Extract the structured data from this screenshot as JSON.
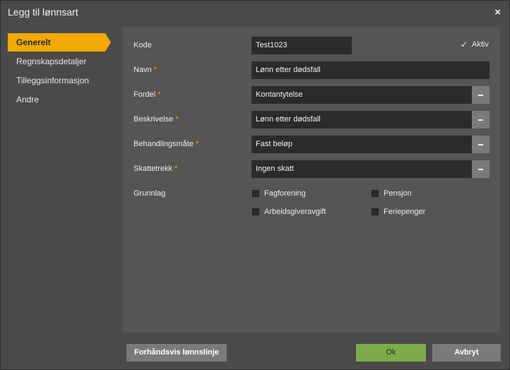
{
  "dialog": {
    "title": "Legg til lønnsart",
    "close_glyph": "×"
  },
  "sidebar": {
    "items": [
      {
        "label": "Generelt",
        "active": true
      },
      {
        "label": "Regnskapsdetaljer",
        "active": false
      },
      {
        "label": "Tilleggsinformasjon",
        "active": false
      },
      {
        "label": "Andre",
        "active": false
      }
    ]
  },
  "form": {
    "kode": {
      "label": "Kode",
      "value": "Test1023"
    },
    "aktiv": {
      "label": "Aktiv",
      "checked": true,
      "glyph": "✓"
    },
    "navn": {
      "label": "Navn",
      "required": "*",
      "value": "Lønn etter dødsfall"
    },
    "fordel": {
      "label": "Fordel",
      "required": "*",
      "value": "Kontantytelse"
    },
    "beskrivelse": {
      "label": "Beskrivelse",
      "required": "*",
      "value": "Lønn etter dødsfall"
    },
    "behandlingsmate": {
      "label": "Behandlingsmåte",
      "required": "*",
      "value": "Fast beløp"
    },
    "skattetrekk": {
      "label": "Skattetrekk",
      "required": "*",
      "value": "Ingen skatt"
    },
    "grunnlag": {
      "label": "Grunnlag",
      "options": [
        {
          "label": "Fagforening",
          "checked": false
        },
        {
          "label": "Pensjon",
          "checked": false
        },
        {
          "label": "Arbeidsgiveravgift",
          "checked": false
        },
        {
          "label": "Feriepenger",
          "checked": false
        }
      ]
    }
  },
  "footer": {
    "preview_label": "Forhåndsvis lønnslinje",
    "ok_label": "Ok",
    "cancel_label": "Avbryt"
  },
  "colors": {
    "accent": "#f2a900",
    "ok": "#7cab48",
    "panel": "#555555",
    "input": "#2b2b2b"
  }
}
